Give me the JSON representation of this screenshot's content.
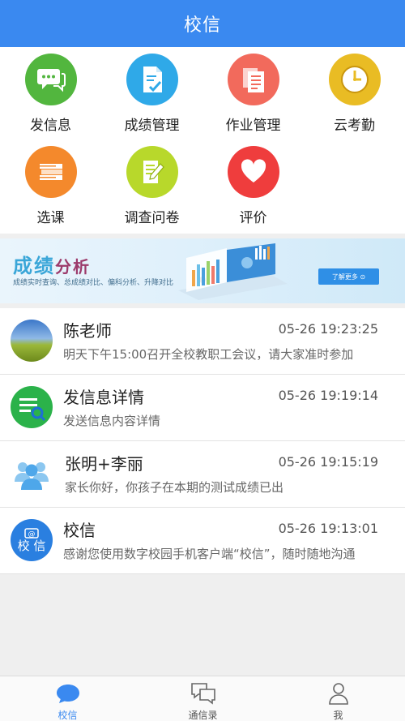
{
  "header": {
    "title": "校信"
  },
  "grid": [
    {
      "label": "发信息",
      "icon": "chat-bubbles-icon",
      "color": "#52b63e"
    },
    {
      "label": "成绩管理",
      "icon": "document-check-icon",
      "color": "#2fa9e8"
    },
    {
      "label": "作业管理",
      "icon": "documents-icon",
      "color": "#f26a5c"
    },
    {
      "label": "云考勤",
      "icon": "clock-icon",
      "color": "#e9bc24"
    },
    {
      "label": "选课",
      "icon": "books-icon",
      "color": "#f4892c"
    },
    {
      "label": "调查问卷",
      "icon": "questionnaire-icon",
      "color": "#b8d82b"
    },
    {
      "label": "评价",
      "icon": "heart-icon",
      "color": "#ef3d3d"
    }
  ],
  "banner": {
    "title_part1": "成绩",
    "title_part2": "分析",
    "subtitle": "成绩实时查询、总成绩对比、偏科分析、升降对比",
    "button_label": "了解更多 ⊙"
  },
  "messages": [
    {
      "name": "陈老师",
      "time": "05-26 19:23:25",
      "preview": "明天下午15:00召开全校教职工会议，请大家准时参加",
      "avatar": "landscape-avatar"
    },
    {
      "name": "发信息详情",
      "time": "05-26 19:19:14",
      "preview": "发送信息内容详情",
      "avatar": "message-detail-icon"
    },
    {
      "name": "张明+李丽",
      "time": "05-26 19:15:19",
      "preview": "家长你好，你孩子在本期的测试成绩已出",
      "avatar": "group-icon"
    },
    {
      "name": "校信",
      "time": "05-26 19:13:01",
      "preview": "感谢您使用数字校园手机客户端“校信”，随时随地沟通",
      "avatar": "school-badge-icon",
      "badge_text": "校 信"
    }
  ],
  "tabs": [
    {
      "label": "校信",
      "icon": "chat-bubble-icon",
      "active": true
    },
    {
      "label": "通信录",
      "icon": "contacts-icon",
      "active": false
    },
    {
      "label": "我",
      "icon": "user-icon",
      "active": false
    }
  ],
  "colors": {
    "primary": "#3a89f0",
    "background": "#efefef"
  }
}
